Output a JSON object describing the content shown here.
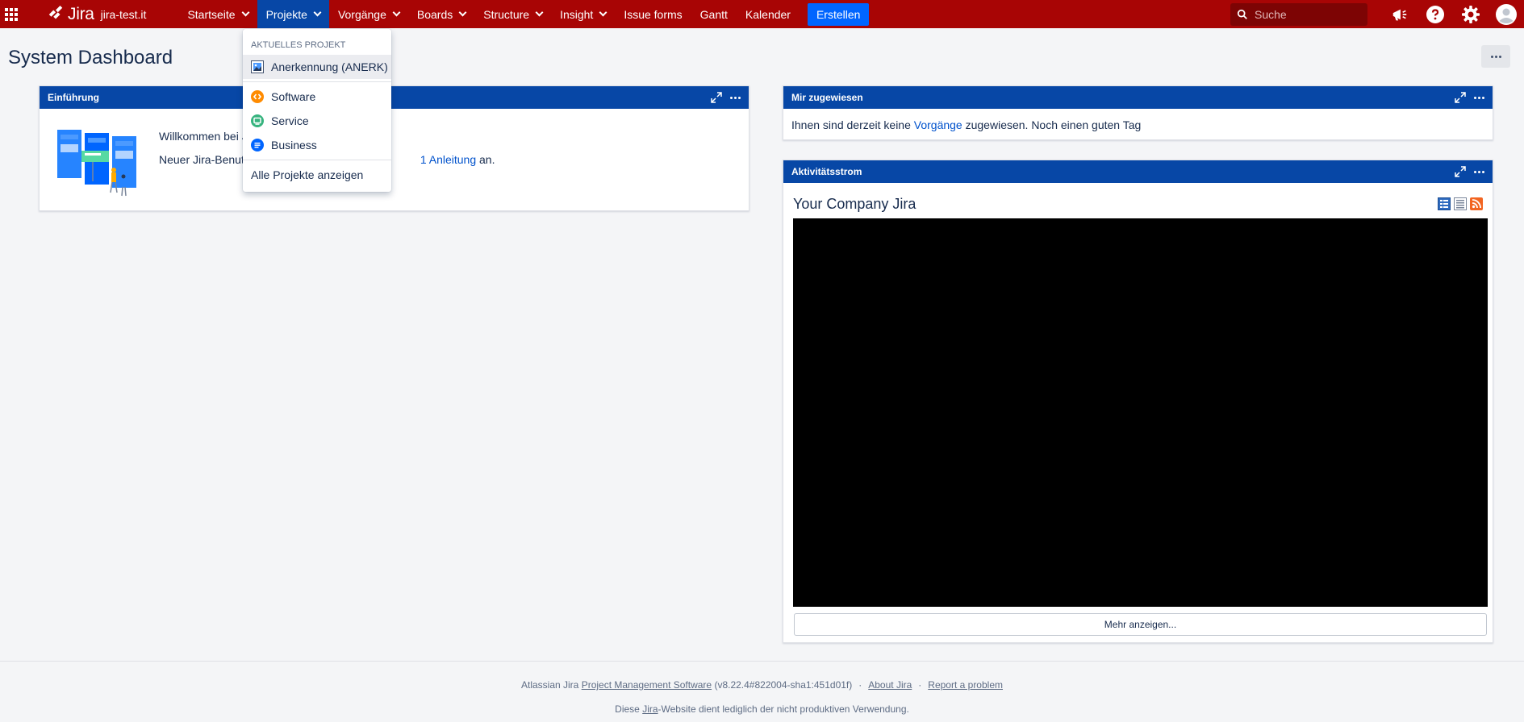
{
  "nav": {
    "logo_text": "Jira",
    "site_name": "jira-test.it",
    "items": [
      {
        "label": "Startseite",
        "has_dropdown": true
      },
      {
        "label": "Projekte",
        "has_dropdown": true,
        "active": true
      },
      {
        "label": "Vorgänge",
        "has_dropdown": true
      },
      {
        "label": "Boards",
        "has_dropdown": true
      },
      {
        "label": "Structure",
        "has_dropdown": true
      },
      {
        "label": "Insight",
        "has_dropdown": true
      },
      {
        "label": "Issue forms",
        "has_dropdown": false
      },
      {
        "label": "Gantt",
        "has_dropdown": false
      },
      {
        "label": "Kalender",
        "has_dropdown": false
      }
    ],
    "create_label": "Erstellen",
    "search_placeholder": "Suche",
    "icons": [
      "app-switcher-icon",
      "megaphone-icon",
      "help-icon",
      "settings-icon",
      "user-avatar-icon"
    ]
  },
  "page": {
    "title": "System Dashboard"
  },
  "projects_dropdown": {
    "section_label": "AKTUELLES PROJEKT",
    "current_project": "Anerkennung (ANERK)",
    "project_types": [
      {
        "label": "Software",
        "icon": "software-project-icon",
        "color": "#ff8b00"
      },
      {
        "label": "Service",
        "icon": "service-project-icon",
        "color": "#36b37e"
      },
      {
        "label": "Business",
        "icon": "business-project-icon",
        "color": "#0065ff"
      }
    ],
    "view_all": "Alle Projekte anzeigen"
  },
  "gadgets": {
    "intro": {
      "title": "Einführung",
      "line1": "Willkommen bei J",
      "line2_prefix": "Neuer Jira-Benut",
      "line2_link": "1 Anleitung",
      "line2_suffix": " an."
    },
    "assigned": {
      "title": "Mir zugewiesen",
      "text_prefix": "Ihnen sind derzeit keine ",
      "link": "Vorgänge",
      "text_suffix": " zugewiesen. Noch einen guten Tag"
    },
    "activity": {
      "title": "Aktivitätsstrom",
      "stream_title": "Your Company Jira",
      "more_button": "Mehr anzeigen..."
    }
  },
  "footer": {
    "prefix": "Atlassian Jira ",
    "pms_link": "Project Management Software",
    "version": " (v8.22.4#822004-sha1:451d01f)",
    "dot": "·",
    "about": "About Jira",
    "report": "Report a problem",
    "line2_prefix": "Diese ",
    "line2_link": "Jira",
    "line2_suffix": "-Website dient lediglich der nicht produktiven Verwendung."
  },
  "colors": {
    "header_bg": "#a80505",
    "active_nav": "#0747a6",
    "create_button": "#0065ff",
    "gadget_header": "#0747a6",
    "link": "#0052cc"
  }
}
